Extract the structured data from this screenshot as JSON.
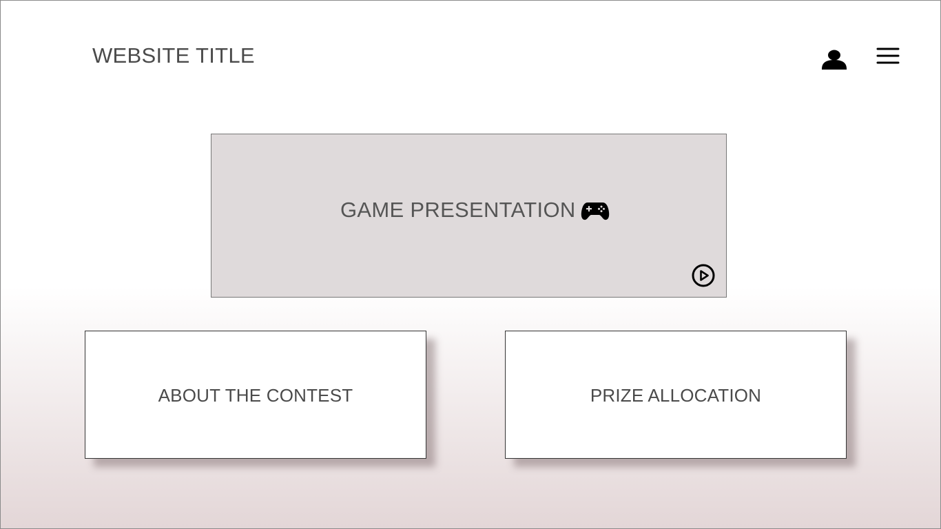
{
  "header": {
    "title": "WEBSITE TITLE",
    "icons": [
      "user-icon",
      "hamburger-menu-icon"
    ]
  },
  "hero": {
    "label": "GAME PRESENTATION",
    "icons": [
      "gamepad-icon",
      "play-circle-icon"
    ],
    "background_color": "#dfdadb"
  },
  "cards": [
    {
      "label": "ABOUT THE CONTEST"
    },
    {
      "label": "PRIZE ALLOCATION"
    }
  ],
  "colors": {
    "text": "#4a4a4a",
    "gradient_bottom": "#e3d6d7"
  }
}
